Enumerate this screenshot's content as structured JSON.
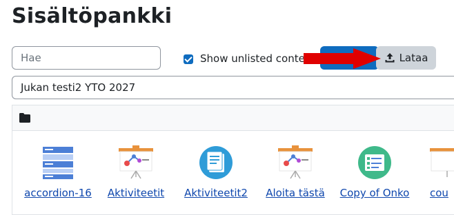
{
  "page": {
    "title": "Sisältöpankki"
  },
  "toolbar": {
    "search_placeholder": "Hae",
    "show_unlisted_label": "Show unlisted conten",
    "upload_label": "Lataa"
  },
  "context": {
    "selected": "Jukan testi2 YTO 2027"
  },
  "items": [
    {
      "label": "accordion-16",
      "icon": "accordion-icon"
    },
    {
      "label": "Aktiviteetit",
      "icon": "presentation-icon"
    },
    {
      "label": "Aktiviteetit2",
      "icon": "document-icon"
    },
    {
      "label": "Aloita tästä",
      "icon": "presentation-icon"
    },
    {
      "label": "Copy of Onko",
      "icon": "form-icon"
    },
    {
      "label": "cou",
      "icon": "presentation-icon"
    }
  ],
  "colors": {
    "accent": "#0f6cbf",
    "link": "#0f47ad",
    "arrow": "#e00000"
  }
}
